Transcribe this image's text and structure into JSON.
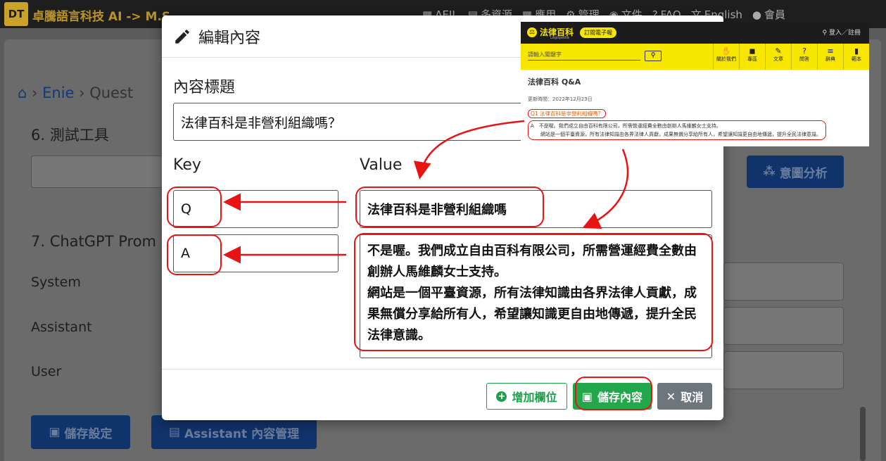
{
  "site": {
    "logo": "DT",
    "brand": "卓騰語言科技 AI -> M.S",
    "nav": [
      {
        "icon": "grid-icon",
        "label": "AEIL"
      },
      {
        "icon": "folder-icon",
        "label": "多資源"
      },
      {
        "icon": "apps-icon",
        "label": "應用"
      },
      {
        "icon": "gear-icon",
        "label": "管理"
      },
      {
        "icon": "doc-icon",
        "label": "文件"
      },
      {
        "icon": "question-icon",
        "label": "FAQ"
      },
      {
        "icon": "translate-icon",
        "label": "English"
      },
      {
        "icon": "user-icon",
        "label": "會員"
      }
    ]
  },
  "background": {
    "breadcrumb": [
      "Enie",
      "Quest"
    ],
    "section6": "6. 測試工具",
    "intent_button": "意圖分析",
    "section7": "7. ChatGPT Prom",
    "labels": [
      "System",
      "Assistant",
      "User"
    ],
    "save_settings": "儲存設定",
    "assistant_manage": "Assistant 內容管理"
  },
  "modal": {
    "title": "編輯內容",
    "content_title_label": "內容標題",
    "content_title_value": "法律百科是非營利組織嗎？",
    "key_header": "Key",
    "value_header": "Value",
    "rows": [
      {
        "key": "Q",
        "value": "法律百科是非營利組織嗎"
      },
      {
        "key": "A",
        "value": "不是喔。我們成立自由百科有限公司，所需營運經費全數由創辦人馬維麟女士支持。\n網站是一個平臺資源，所有法律知識由各界法律人貢獻，成果無償分享給所有人，希望讓知識更自由地傳遞，提升全民法律意識。"
      }
    ],
    "add_field": "增加欄位",
    "save_content": "儲存內容",
    "cancel": "取消"
  },
  "inset": {
    "logo": "法律百科",
    "logo_sub": "Legispedia",
    "subscribe": "訂閱電子報",
    "login": "登入／註冊",
    "search_placeholder": "請輸入關鍵字",
    "nav": [
      {
        "label": "關於我們"
      },
      {
        "label": "專區"
      },
      {
        "label": "文章"
      },
      {
        "label": "問答"
      },
      {
        "label": "辭典"
      },
      {
        "label": "範本"
      }
    ],
    "title": "法律百科 Q&A",
    "date": "更新時間：2022年12月23日",
    "q": "Q1 法律百科是非營利組織嗎？",
    "a1": "A　不是喔。我們成立自由百科有限公司，所需營運經費全數由創辦人馬維麟女士支持。",
    "a2": "網站是一個平臺資源，所有法律知識由各界法律人貢獻，成果無償分享給所有人，希望讓知識更自由地傳遞，提升全民法律意識。"
  },
  "colors": {
    "accent_green": "#22a84a",
    "annotation_red": "#e81414",
    "inset_yellow": "#f6e600"
  }
}
